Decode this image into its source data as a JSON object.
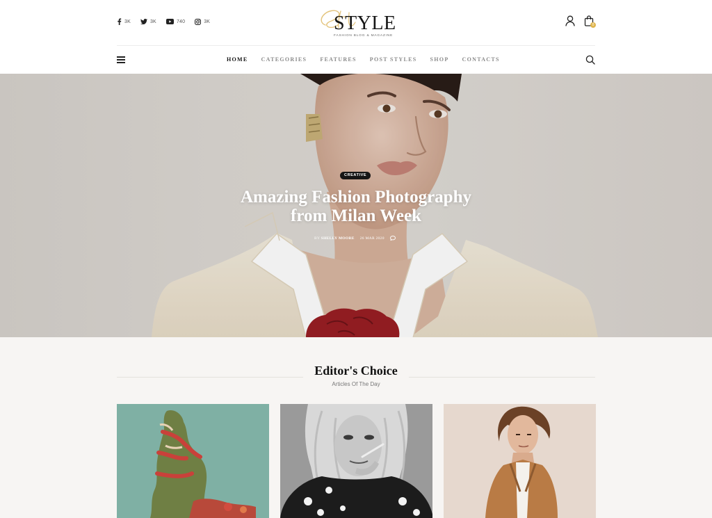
{
  "social": [
    {
      "icon": "facebook-icon",
      "count": "3K"
    },
    {
      "icon": "twitter-icon",
      "count": "3K"
    },
    {
      "icon": "youtube-icon",
      "count": "740"
    },
    {
      "icon": "instagram-icon",
      "count": "3K"
    }
  ],
  "logo": {
    "word": "STYLE",
    "tagline": "FASHION BLOG & MAGAZINE"
  },
  "cart": {
    "count": "0"
  },
  "nav": {
    "items": [
      "HOME",
      "CATEGORIES",
      "FEATURES",
      "POST STYLES",
      "SHOP",
      "CONTACTS"
    ],
    "active": "HOME"
  },
  "hero": {
    "category": "CREATIVE",
    "title_line1": "Amazing Fashion Photography",
    "title_line2": "from Milan Week",
    "by": "BY",
    "author": "SHELLY MOORE",
    "date": "26 MAR 2020"
  },
  "section": {
    "title": "Editor's Choice",
    "subtitle": "Articles Of The Day"
  },
  "colors": {
    "accent": "#e0b64f",
    "dark": "#151515",
    "section_bg": "#f7f5f3"
  }
}
